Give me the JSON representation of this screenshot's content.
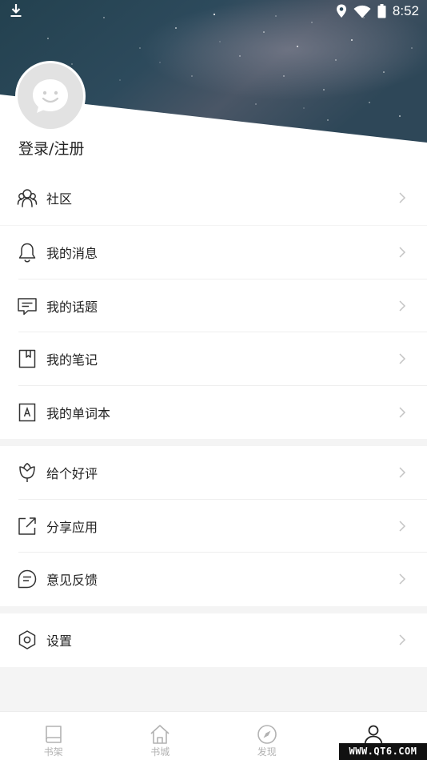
{
  "status_bar": {
    "time": "8:52"
  },
  "profile": {
    "login_label": "登录/注册"
  },
  "sections": [
    {
      "items": [
        {
          "label": "社区",
          "icon": "community-icon"
        }
      ]
    },
    {
      "items": [
        {
          "label": "我的消息",
          "icon": "bell-icon"
        },
        {
          "label": "我的话题",
          "icon": "chat-bubble-icon"
        },
        {
          "label": "我的笔记",
          "icon": "bookmark-note-icon"
        },
        {
          "label": "我的单词本",
          "icon": "letter-a-icon"
        }
      ]
    },
    {
      "items": [
        {
          "label": "给个好评",
          "icon": "tulip-icon"
        },
        {
          "label": "分享应用",
          "icon": "share-icon"
        },
        {
          "label": "意见反馈",
          "icon": "feedback-icon"
        }
      ]
    },
    {
      "items": [
        {
          "label": "设置",
          "icon": "hexagon-settings-icon"
        }
      ]
    }
  ],
  "tabbar": {
    "tabs": [
      {
        "label": "书架",
        "icon": "bookshelf-icon",
        "active": false
      },
      {
        "label": "书城",
        "icon": "home-icon",
        "active": false
      },
      {
        "label": "发现",
        "icon": "compass-icon",
        "active": false
      },
      {
        "label": "",
        "icon": "person-icon",
        "active": true
      }
    ]
  },
  "watermark": {
    "text": "WWW.QT6.COM"
  },
  "colors": {
    "text": "#222222",
    "icon": "#333333",
    "muted": "#b2b2b2",
    "background": "#f4f4f4",
    "sky": "#2a4656"
  }
}
